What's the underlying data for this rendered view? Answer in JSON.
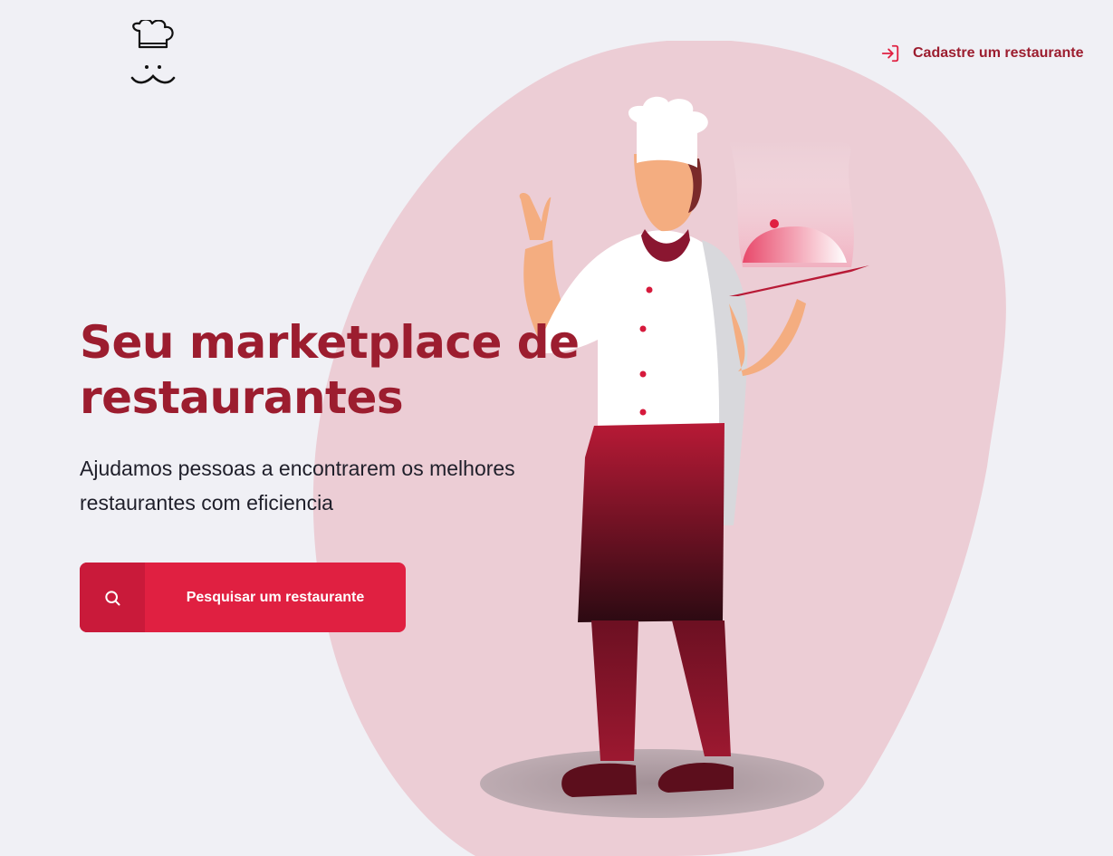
{
  "header": {
    "logo_icon": "chef-hat-mustache-logo",
    "register_link": {
      "label": "Cadastre um restaurante",
      "icon": "login-arrow-icon"
    }
  },
  "hero": {
    "title": "Seu marketplace de restaurantes",
    "subtitle": "Ajudamos pessoas a encontrarem os melhores restaurantes com eficiencia",
    "search_button": {
      "label": "Pesquisar um restaurante",
      "icon": "search-icon"
    }
  },
  "illustration": {
    "name": "chef-holding-cloche",
    "background_blob": "pink-blob"
  },
  "colors": {
    "background": "#f0f0f5",
    "brand_dark_red": "#9c1d2f",
    "accent_red": "#e02041",
    "blob_pink": "#eccdd5"
  }
}
